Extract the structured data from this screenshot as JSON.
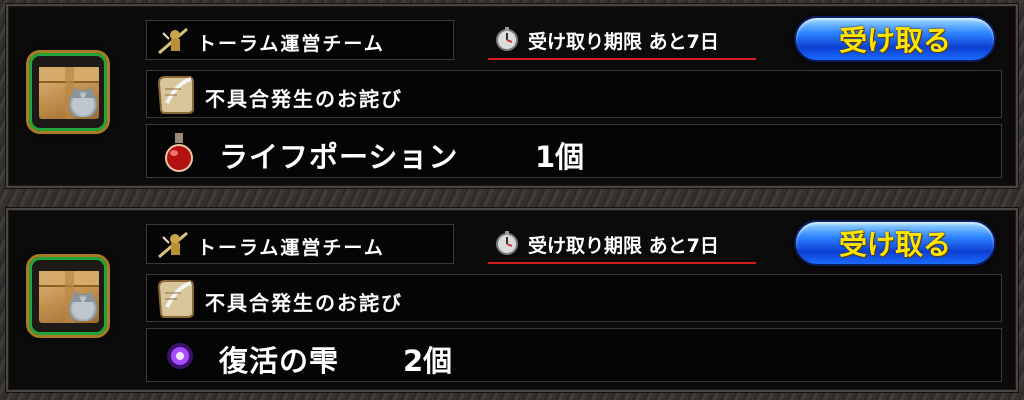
{
  "mails": [
    {
      "sender": "トーラム運営チーム",
      "deadline": "受け取り期限 あと7日",
      "claim_label": "受け取る",
      "subject": "不具合発生のお詫び",
      "item_name": "ライフポーション",
      "item_qty": "1個",
      "item_icon": "red-potion-icon"
    },
    {
      "sender": "トーラム運営チーム",
      "deadline": "受け取り期限 あと7日",
      "claim_label": "受け取る",
      "subject": "不具合発生のお詫び",
      "item_name": "復活の雫",
      "item_qty": "2個",
      "item_icon": "purple-orb-icon"
    }
  ],
  "colors": {
    "claim_text": "#ffe400",
    "deadline_underline": "#d51d1d",
    "thumb_border": "#23a43a"
  }
}
